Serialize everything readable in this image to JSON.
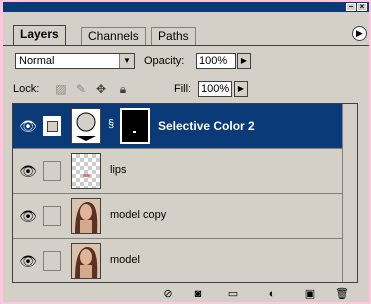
{
  "tabs": [
    "Layers",
    "Channels",
    "Paths"
  ],
  "blend_mode": "Normal",
  "opacity_label": "Opacity:",
  "opacity_value": "100%",
  "lock_label": "Lock:",
  "fill_label": "Fill:",
  "fill_value": "100%",
  "layers": [
    {
      "name": "Selective Color 2",
      "selected": true
    },
    {
      "name": "lips",
      "selected": false
    },
    {
      "name": "model copy",
      "selected": false
    },
    {
      "name": "model",
      "selected": false
    }
  ],
  "colors": {
    "titlebar": "#0a3a78",
    "panel": "#d4d0c8",
    "selected_row": "#0a3a78"
  }
}
